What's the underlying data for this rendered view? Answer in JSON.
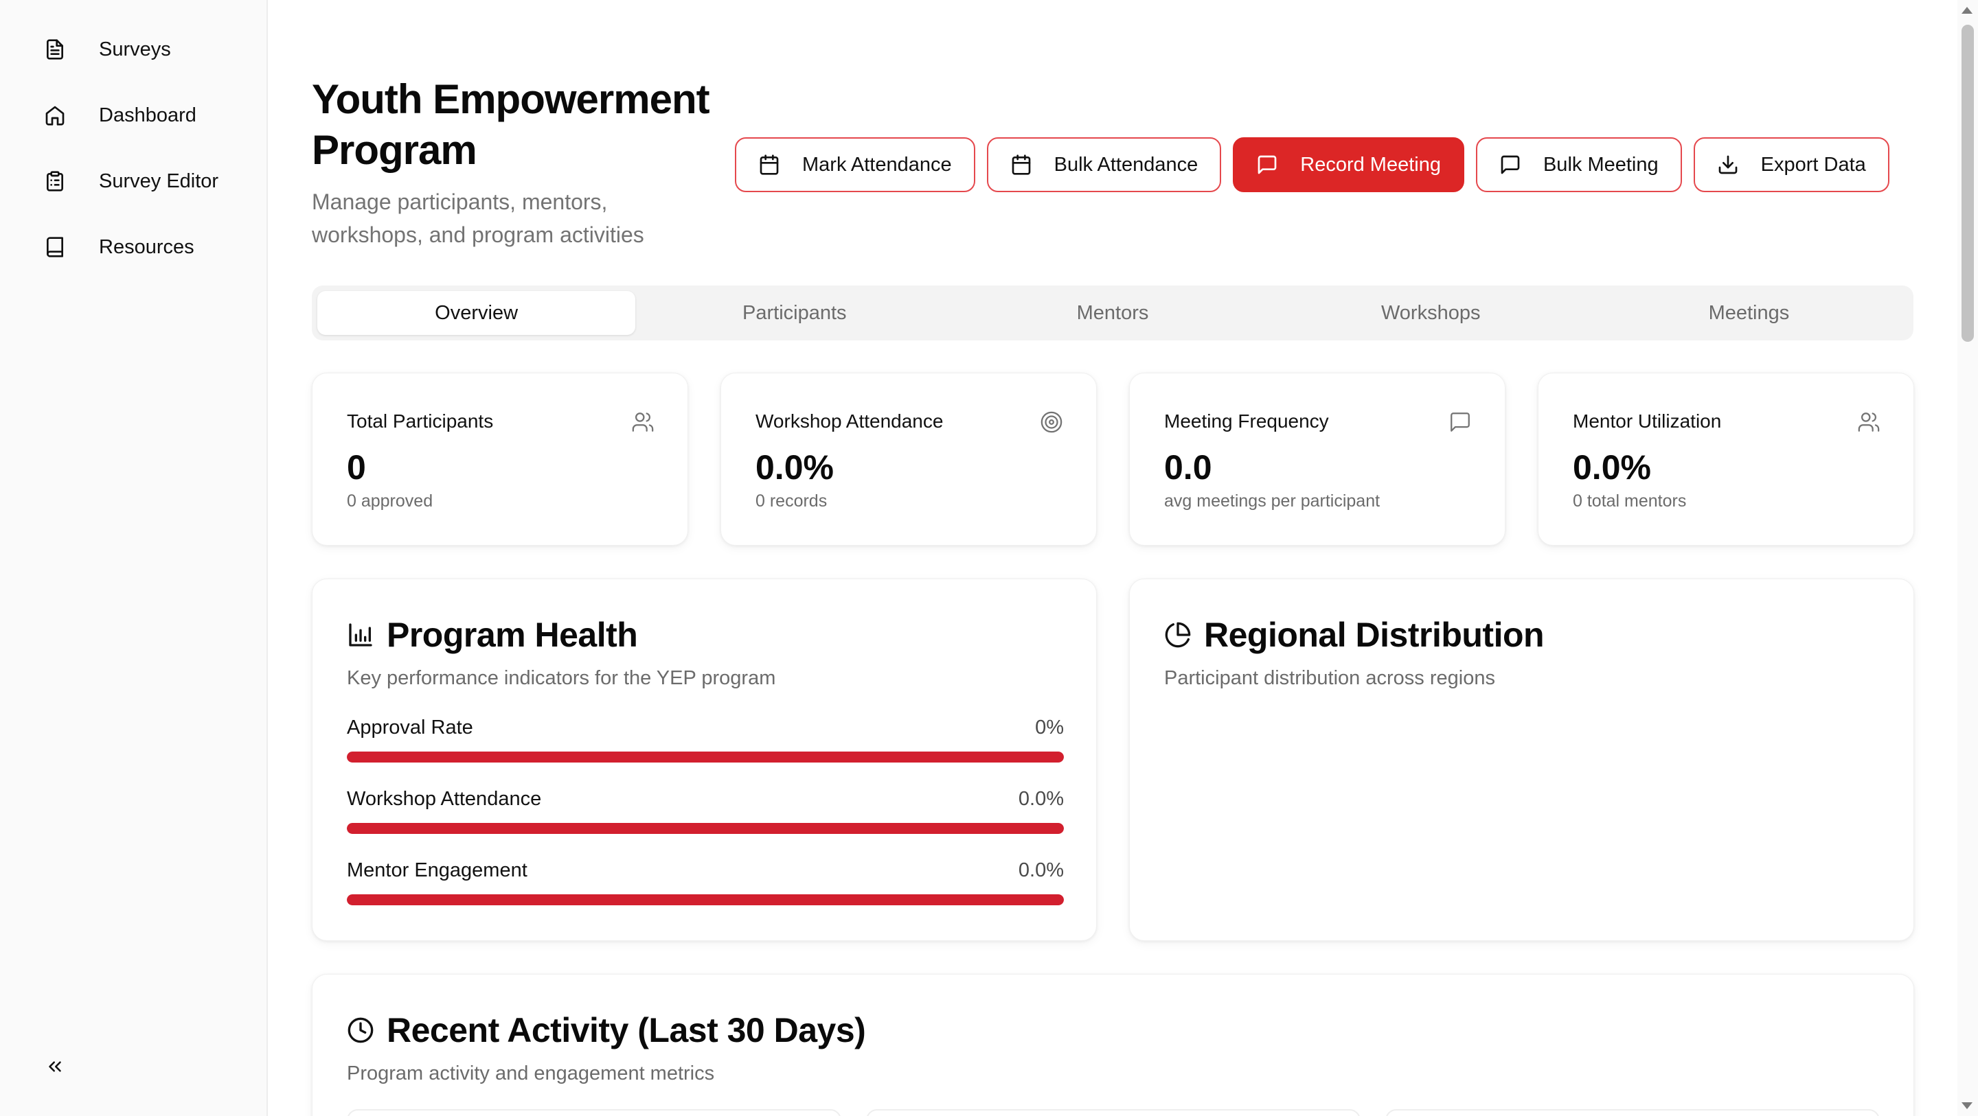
{
  "sidebar": {
    "items": [
      {
        "label": "Surveys",
        "icon": "file-text-icon"
      },
      {
        "label": "Dashboard",
        "icon": "home-icon"
      },
      {
        "label": "Survey Editor",
        "icon": "clipboard-icon"
      },
      {
        "label": "Resources",
        "icon": "book-icon"
      }
    ],
    "collapse_icon": "chevrons-left-icon"
  },
  "header": {
    "title": "Youth Empowerment Program",
    "subtitle": "Manage participants, mentors, workshops, and program activities"
  },
  "actions": [
    {
      "label": "Mark Attendance",
      "icon": "calendar-icon",
      "primary": false
    },
    {
      "label": "Bulk Attendance",
      "icon": "calendar-icon",
      "primary": false
    },
    {
      "label": "Record Meeting",
      "icon": "message-square-icon",
      "primary": true
    },
    {
      "label": "Bulk Meeting",
      "icon": "message-square-icon",
      "primary": false
    },
    {
      "label": "Export Data",
      "icon": "download-icon",
      "primary": false
    }
  ],
  "tabs": [
    "Overview",
    "Participants",
    "Mentors",
    "Workshops",
    "Meetings"
  ],
  "active_tab": "Overview",
  "stats": [
    {
      "title": "Total Participants",
      "value": "0",
      "note": "0 approved",
      "icon": "users-icon"
    },
    {
      "title": "Workshop Attendance",
      "value": "0.0%",
      "note": "0 records",
      "icon": "target-icon"
    },
    {
      "title": "Meeting Frequency",
      "value": "0.0",
      "note": "avg meetings per participant",
      "icon": "message-square-icon"
    },
    {
      "title": "Mentor Utilization",
      "value": "0.0%",
      "note": "0 total mentors",
      "icon": "users-icon"
    }
  ],
  "program_health": {
    "title": "Program Health",
    "description": "Key performance indicators for the YEP program",
    "icon": "bar-chart-icon",
    "metrics": [
      {
        "label": "Approval Rate",
        "value": "0%",
        "fill": 1.0
      },
      {
        "label": "Workshop Attendance",
        "value": "0.0%",
        "fill": 1.0
      },
      {
        "label": "Mentor Engagement",
        "value": "0.0%",
        "fill": 1.0
      }
    ]
  },
  "regional": {
    "title": "Regional Distribution",
    "description": "Participant distribution across regions",
    "icon": "pie-chart-icon"
  },
  "recent": {
    "title": "Recent Activity (Last 30 Days)",
    "description": "Program activity and engagement metrics",
    "icon": "clock-icon"
  },
  "colors": {
    "accent": "#dc2626",
    "accent_border": "#e5484d",
    "muted_text": "#6b6b6b"
  }
}
